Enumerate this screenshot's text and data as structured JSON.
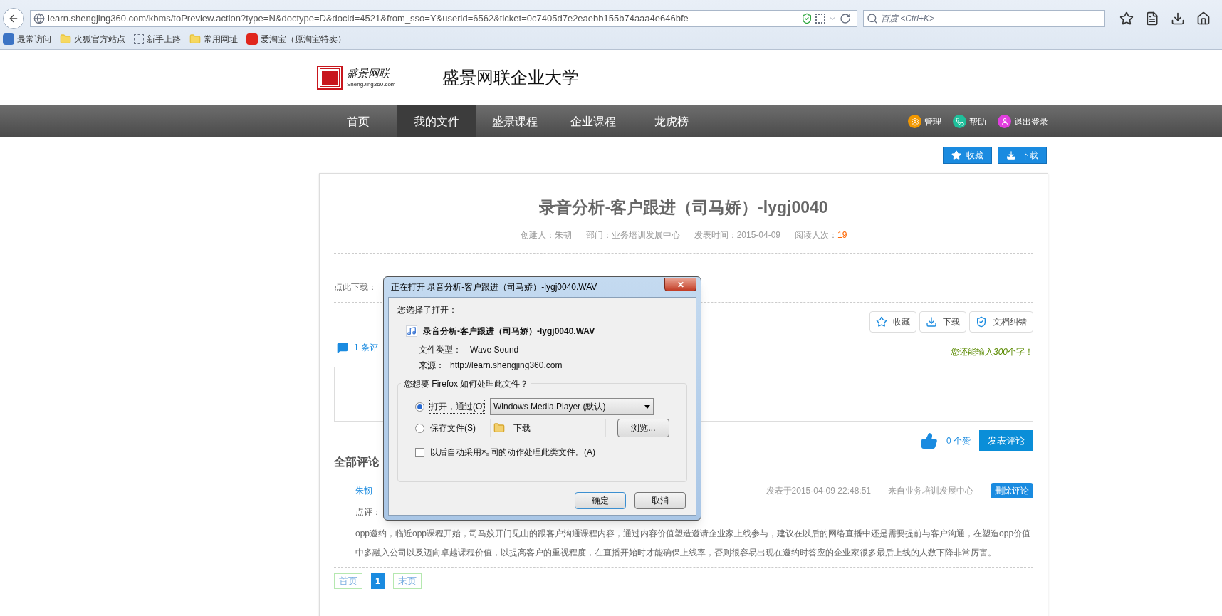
{
  "browser": {
    "url": "learn.shengjing360.com/kbms/toPreview.action?type=N&doctype=D&docid=4521&from_sso=Y&userid=6562&ticket=0c7405d7e2eaebb155b74aaa4e646bfe",
    "search_placeholder": "百度 <Ctrl+K>",
    "bookmarks": [
      {
        "label": "最常访问",
        "kind": "recent"
      },
      {
        "label": "火狐官方站点",
        "kind": "folder"
      },
      {
        "label": "新手上路",
        "kind": "page"
      },
      {
        "label": "常用网址",
        "kind": "folder"
      },
      {
        "label": "爱淘宝（原淘宝特卖）",
        "kind": "shop"
      }
    ]
  },
  "header": {
    "logo_mark": "盛景网联",
    "logo_caption": "ShengJing360.com",
    "site_title": "盛景网联企业大学"
  },
  "nav": [
    {
      "label": "首页",
      "selected": false
    },
    {
      "label": "我的文件",
      "selected": true
    },
    {
      "label": "盛景课程",
      "selected": false
    },
    {
      "label": "企业课程",
      "selected": false
    },
    {
      "label": "龙虎榜",
      "selected": false
    }
  ],
  "nav_actions": [
    {
      "label": "管理",
      "kind": "gear"
    },
    {
      "label": "帮助",
      "kind": "phone"
    },
    {
      "label": "退出登录",
      "kind": "user"
    }
  ],
  "top_buttons": [
    {
      "label": "收藏",
      "kind": "star"
    },
    {
      "label": "下载",
      "kind": "download"
    }
  ],
  "document": {
    "title": "录音分析-客户跟进（司马娇）-lygj0040",
    "meta": [
      {
        "label": "创建人：",
        "value": "朱韧",
        "highlight": false
      },
      {
        "label": "部门：",
        "value": "业务培训发展中心",
        "highlight": false
      },
      {
        "label": "发表时间：",
        "value": "2015-04-09",
        "highlight": false
      },
      {
        "label": "阅读人次：",
        "value": "19",
        "highlight": true
      }
    ],
    "download_label": "点此下载："
  },
  "actions": [
    {
      "label": "收藏",
      "kind": "star"
    },
    {
      "label": "下载",
      "kind": "download"
    },
    {
      "label": "文档纠错",
      "kind": "shield"
    }
  ],
  "comment_count": "1 条评",
  "remaining": {
    "before": "您还能输入",
    "count": "300",
    "after": "个字！"
  },
  "likes": "0 个赞",
  "submit": "发表评论",
  "all_comments": {
    "heading": "全部评论",
    "author": "朱韧",
    "date": "发表于2015-04-09 22:48:51",
    "source": "来自业务培训发展中心",
    "delete": "删除评论",
    "review_label": "点评：",
    "body": "opp邀约，临近opp课程开始，司马姣开门见山的跟客户沟通课程内容，通过内容价值塑造邀请企业家上线参与，建议在以后的网络直播中还是需要提前与客户沟通，在塑造opp价值中多融入公司以及迈向卓越课程价值，以提高客户的重视程度，在直播开始时才能确保上线率，否则很容易出现在邀约时答应的企业家很多最后上线的人数下降非常厉害。"
  },
  "pagination": [
    {
      "label": "首页",
      "selected": false
    },
    {
      "label": "1",
      "selected": true
    },
    {
      "label": "末页",
      "selected": false
    }
  ],
  "dialog": {
    "close": "✕",
    "title": "正在打开 录音分析-客户跟进（司马娇）-lygj0040.WAV",
    "chosen": "您选择了打开：",
    "file_name": "录音分析-客户跟进（司马娇）-lygj0040.WAV",
    "type_label": "文件类型：",
    "type_value": "Wave Sound",
    "source_label": "来源：",
    "source_value": "http://learn.shengjing360.com",
    "question": "您想要 Firefox 如何处理此文件？",
    "options": [
      {
        "label": "打开，通过(O)",
        "selected": true,
        "kind": "app",
        "value": "Windows Media Player (默认)"
      },
      {
        "label": "保存文件(S)",
        "selected": false,
        "kind": "folder",
        "value": "下载",
        "button": "浏览..."
      }
    ],
    "remember": {
      "label": "以后自动采用相同的动作处理此类文件。(A)",
      "checked": false
    },
    "buttons": [
      "确定",
      "取消"
    ]
  }
}
